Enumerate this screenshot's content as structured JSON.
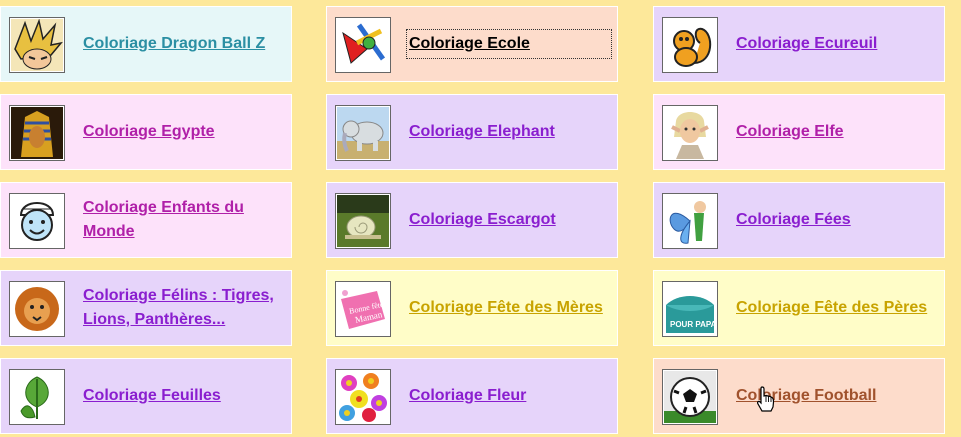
{
  "theme": {
    "cyan_bg": "#e6f7f8",
    "cyan_text": "#2b8fa3",
    "pink_bg": "#fde2fa",
    "pink_text": "#b020a8",
    "lavender_bg": "#e6d4fa",
    "lavender_text": "#8a1ecf",
    "peach_bg": "#fddccb",
    "peach_text": "#000000",
    "football_text": "#a0522d",
    "yellow_bg": "#fffdc8",
    "yellow_text": "#c8a300"
  },
  "grid": {
    "items": [
      {
        "label": "Coloriage Dragon Ball Z",
        "icon": "dragon-ball-z-thumbnail-icon"
      },
      {
        "label": "Coloriage Ecole",
        "icon": "school-thumbnail-icon"
      },
      {
        "label": "Coloriage Ecureuil",
        "icon": "squirrel-thumbnail-icon"
      },
      {
        "label": "Coloriage Egypte",
        "icon": "pharaoh-thumbnail-icon"
      },
      {
        "label": "Coloriage Elephant",
        "icon": "elephant-thumbnail-icon"
      },
      {
        "label": "Coloriage Elfe",
        "icon": "elf-thumbnail-icon"
      },
      {
        "label": "Coloriage Enfants du Monde",
        "icon": "child-thumbnail-icon"
      },
      {
        "label": "Coloriage Escargot",
        "icon": "snail-thumbnail-icon"
      },
      {
        "label": "Coloriage Fées",
        "icon": "fairy-thumbnail-icon"
      },
      {
        "label": "Coloriage Félins : Tigres, Lions, Panthères...",
        "icon": "lion-thumbnail-icon"
      },
      {
        "label": "Coloriage Fête des Mères",
        "icon": "mothers-day-thumbnail-icon"
      },
      {
        "label": "Coloriage Fête des Pères",
        "icon": "fathers-day-thumbnail-icon"
      },
      {
        "label": "Coloriage Feuilles",
        "icon": "leaves-thumbnail-icon"
      },
      {
        "label": "Coloriage Fleur",
        "icon": "flowers-thumbnail-icon"
      },
      {
        "label": "Coloriage Football",
        "icon": "football-thumbnail-icon"
      }
    ],
    "thumb_text": {
      "mothers_day_1": "Bonne fête",
      "mothers_day_2": "Maman",
      "fathers_day": "POUR PAPA"
    }
  },
  "cursor": {
    "icon": "hand-pointer-icon"
  }
}
